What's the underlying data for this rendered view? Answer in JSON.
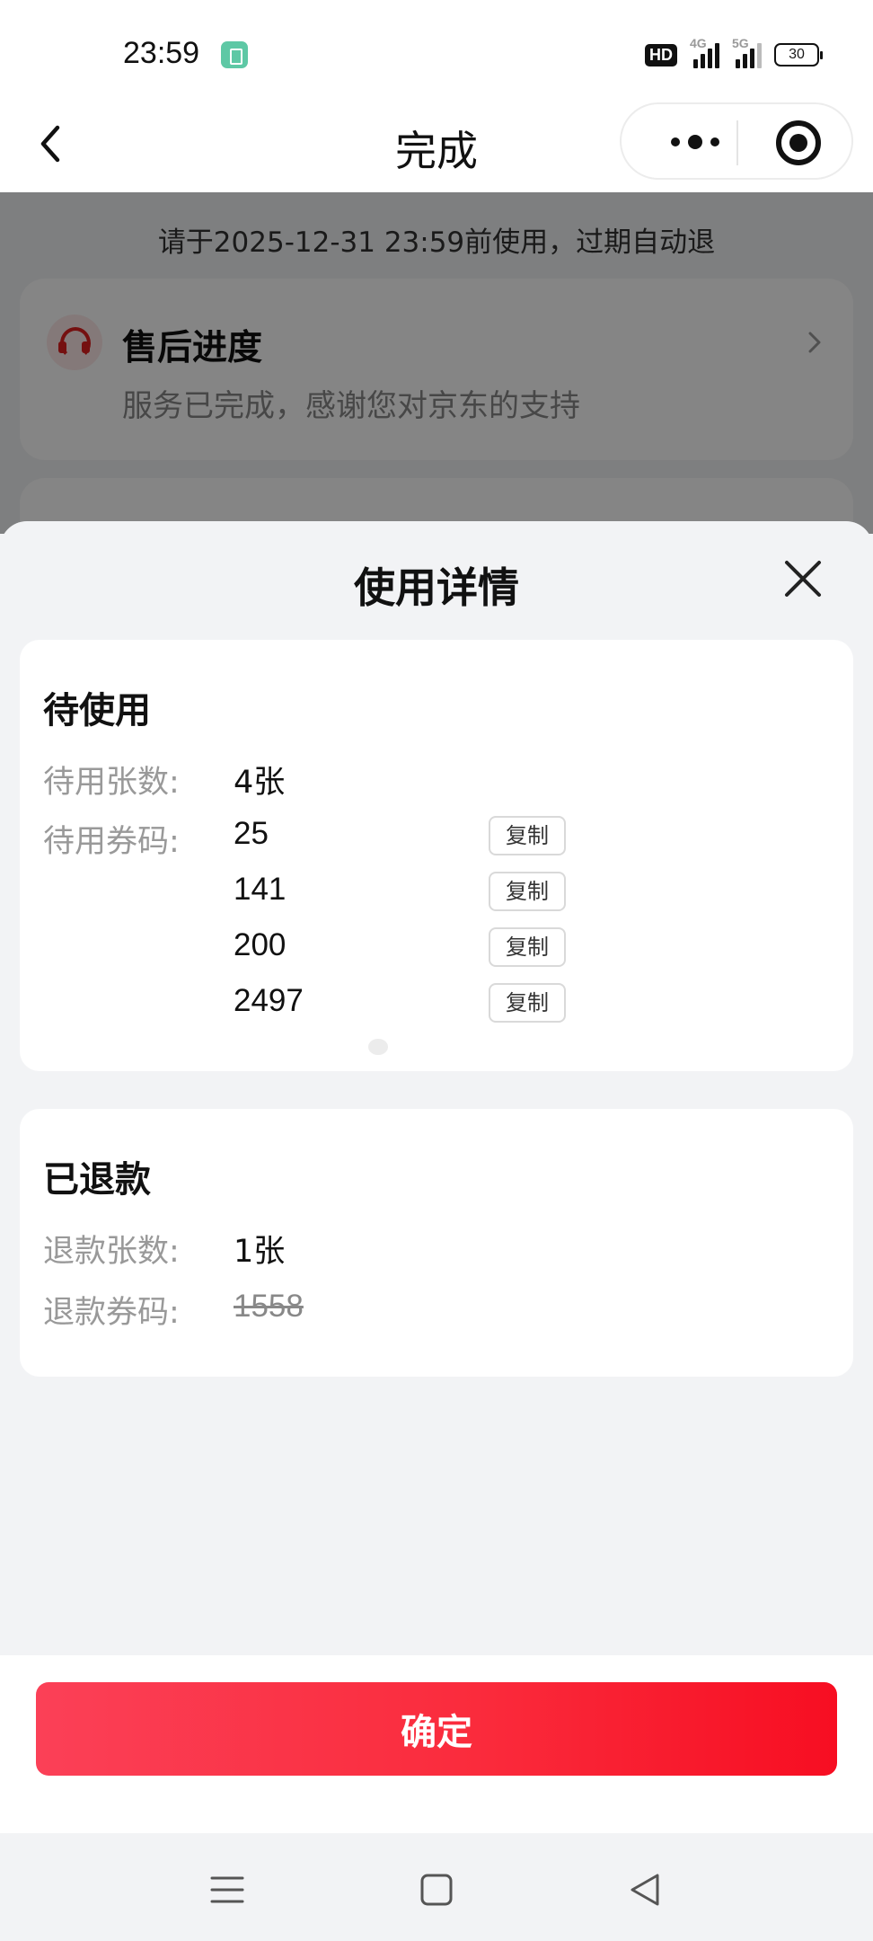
{
  "status_bar": {
    "time": "23:59",
    "hd_label": "HD",
    "signal_1_label": "4G",
    "signal_2_label": "5G",
    "battery": "30"
  },
  "nav": {
    "title": "完成",
    "back_icon": "chevron-left-icon",
    "more_icon": "more-dots-icon",
    "target_icon": "target-icon"
  },
  "background_page": {
    "tip": "请于2025-12-31 23:59前使用，过期自动退",
    "after_sale_title": "售后进度",
    "after_sale_subtitle": "服务已完成，感谢您对京东的支持"
  },
  "sheet": {
    "title": "使用详情",
    "pending": {
      "heading": "待使用",
      "count_label": "待用张数:",
      "count_value": "4张",
      "codes_label": "待用券码:",
      "codes": [
        "25",
        "141",
        "200",
        "2497"
      ],
      "copy_label": "复制"
    },
    "refunded": {
      "heading": "已退款",
      "count_label": "退款张数:",
      "count_value": "1张",
      "codes_label": "退款券码:",
      "code": "1558"
    },
    "confirm_label": "确定"
  },
  "system_nav": {
    "menu_icon": "menu-icon",
    "home_icon": "home-square-icon",
    "back_icon": "back-triangle-icon"
  },
  "colors": {
    "brand_red": "#fa2b3c",
    "text_primary": "#111111",
    "text_secondary": "#999999",
    "page_bg": "#f2f3f5"
  }
}
